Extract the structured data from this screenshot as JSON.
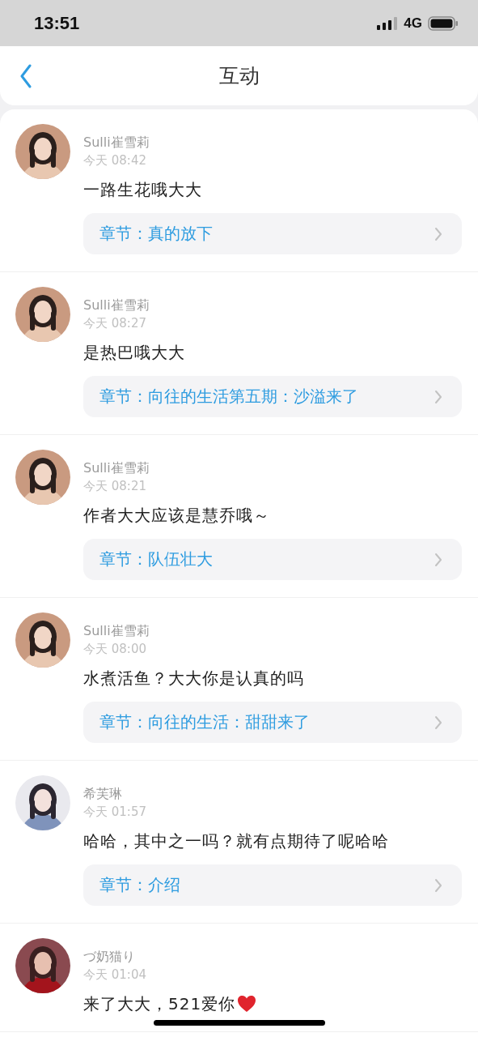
{
  "status_bar": {
    "time": "13:51",
    "network": "4G"
  },
  "header": {
    "title": "互动"
  },
  "comments": [
    {
      "user": "Sulli崔雪莉",
      "time": "今天 08:42",
      "text": "一路生花哦大大",
      "chapter": "章节：真的放下"
    },
    {
      "user": "Sulli崔雪莉",
      "time": "今天 08:27",
      "text": "是热巴哦大大",
      "chapter": "章节：向往的生活第五期：沙溢来了"
    },
    {
      "user": "Sulli崔雪莉",
      "time": "今天 08:21",
      "text": "作者大大应该是慧乔哦～",
      "chapter": "章节：队伍壮大"
    },
    {
      "user": "Sulli崔雪莉",
      "time": "今天 08:00",
      "text": "水煮活鱼？大大你是认真的吗",
      "chapter": "章节：向往的生活：甜甜来了"
    },
    {
      "user": "希芙琳",
      "time": "今天 01:57",
      "text": "哈哈，其中之一吗？就有点期待了呢哈哈",
      "chapter": "章节：介绍"
    },
    {
      "user": "づ奶猫り",
      "time": "今天 01:04",
      "text": "来了大大，521爱你",
      "heart": true
    }
  ]
}
